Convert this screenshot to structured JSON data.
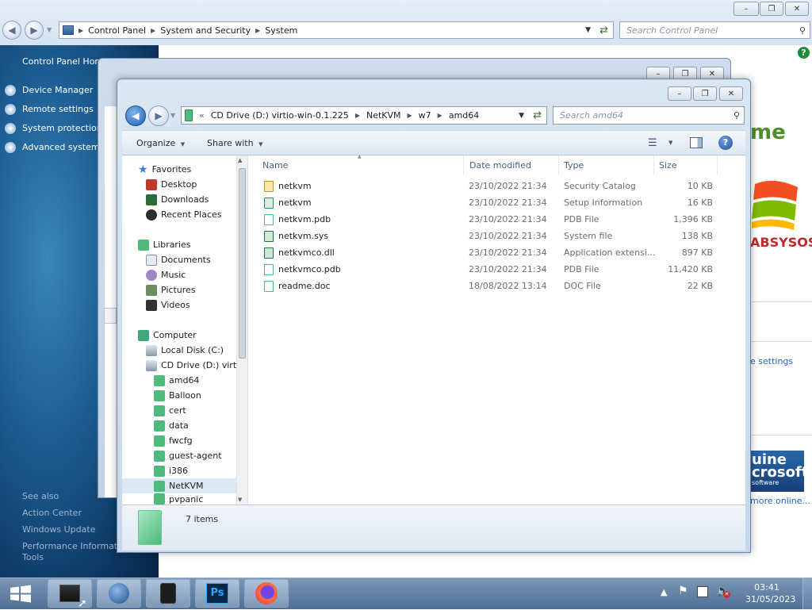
{
  "control_panel": {
    "breadcrumb": [
      "Control Panel",
      "System and Security",
      "System"
    ],
    "search_placeholder": "Search Control Panel",
    "left_header": "Control Panel Hon",
    "left_links": [
      "Device Manager",
      "Remote settings",
      "System protection",
      "Advanced system s"
    ],
    "see_also_title": "See also",
    "see_also_links": [
      "Action Center",
      "Windows Update",
      "Performance Informatio",
      "Tools"
    ],
    "right_fragments": {
      "brand": "me",
      "company": "ABSYSOS",
      "change_settings": "e settings",
      "genuine_badge": "uine\ncrosoft",
      "genuine_sub": "software",
      "more_online": "more online..."
    }
  },
  "explorer": {
    "breadcrumb": [
      "CD Drive (D:) virtio-win-0.1.225",
      "NetKVM",
      "w7",
      "amd64"
    ],
    "breadcrumb_prefix": "«",
    "search_placeholder": "Search amd64",
    "toolbar": {
      "organize": "Organize",
      "share_with": "Share with"
    },
    "nav": {
      "favorites_header": "Favorites",
      "favorites": [
        "Desktop",
        "Downloads",
        "Recent Places"
      ],
      "libraries_header": "Libraries",
      "libraries": [
        "Documents",
        "Music",
        "Pictures",
        "Videos"
      ],
      "computer_header": "Computer",
      "drives": [
        "Local Disk (C:)",
        "CD Drive (D:) virtio"
      ],
      "folders": [
        "amd64",
        "Balloon",
        "cert",
        "data",
        "fwcfg",
        "guest-agent",
        "i386",
        "NetKVM",
        "pvpanic"
      ],
      "selected": "NetKVM"
    },
    "columns": [
      "Name",
      "Date modified",
      "Type",
      "Size"
    ],
    "files": [
      {
        "name": "netkvm",
        "date": "23/10/2022 21:34",
        "type": "Security Catalog",
        "size": "10 KB",
        "icon": "security-catalog-icon"
      },
      {
        "name": "netkvm",
        "date": "23/10/2022 21:34",
        "type": "Setup Information",
        "size": "16 KB",
        "icon": "setup-information-icon"
      },
      {
        "name": "netkvm.pdb",
        "date": "23/10/2022 21:34",
        "type": "PDB File",
        "size": "1,396 KB",
        "icon": "generic-file-icon"
      },
      {
        "name": "netkvm.sys",
        "date": "23/10/2022 21:34",
        "type": "System file",
        "size": "138 KB",
        "icon": "system-file-icon"
      },
      {
        "name": "netkvmco.dll",
        "date": "23/10/2022 21:34",
        "type": "Application extensi...",
        "size": "897 KB",
        "icon": "dll-file-icon"
      },
      {
        "name": "netkvmco.pdb",
        "date": "23/10/2022 21:34",
        "type": "PDB File",
        "size": "11,420 KB",
        "icon": "generic-file-icon"
      },
      {
        "name": "readme.doc",
        "date": "18/08/2022 13:14",
        "type": "DOC File",
        "size": "22 KB",
        "icon": "generic-file-icon"
      }
    ],
    "details": {
      "item_count": "7 items"
    }
  },
  "taskbar": {
    "apps": [
      "explorer-icon",
      "windows-logo-icon",
      "calculator-icon",
      "photoshop-icon",
      "firefox-icon"
    ],
    "photoshop_label": "Ps",
    "clock_time": "03:41",
    "clock_date": "31/05/2023"
  },
  "colors": {
    "accent": "#1f66c2",
    "taskbar": "#5b7aa0",
    "folder_green": "#4cbb7d"
  }
}
